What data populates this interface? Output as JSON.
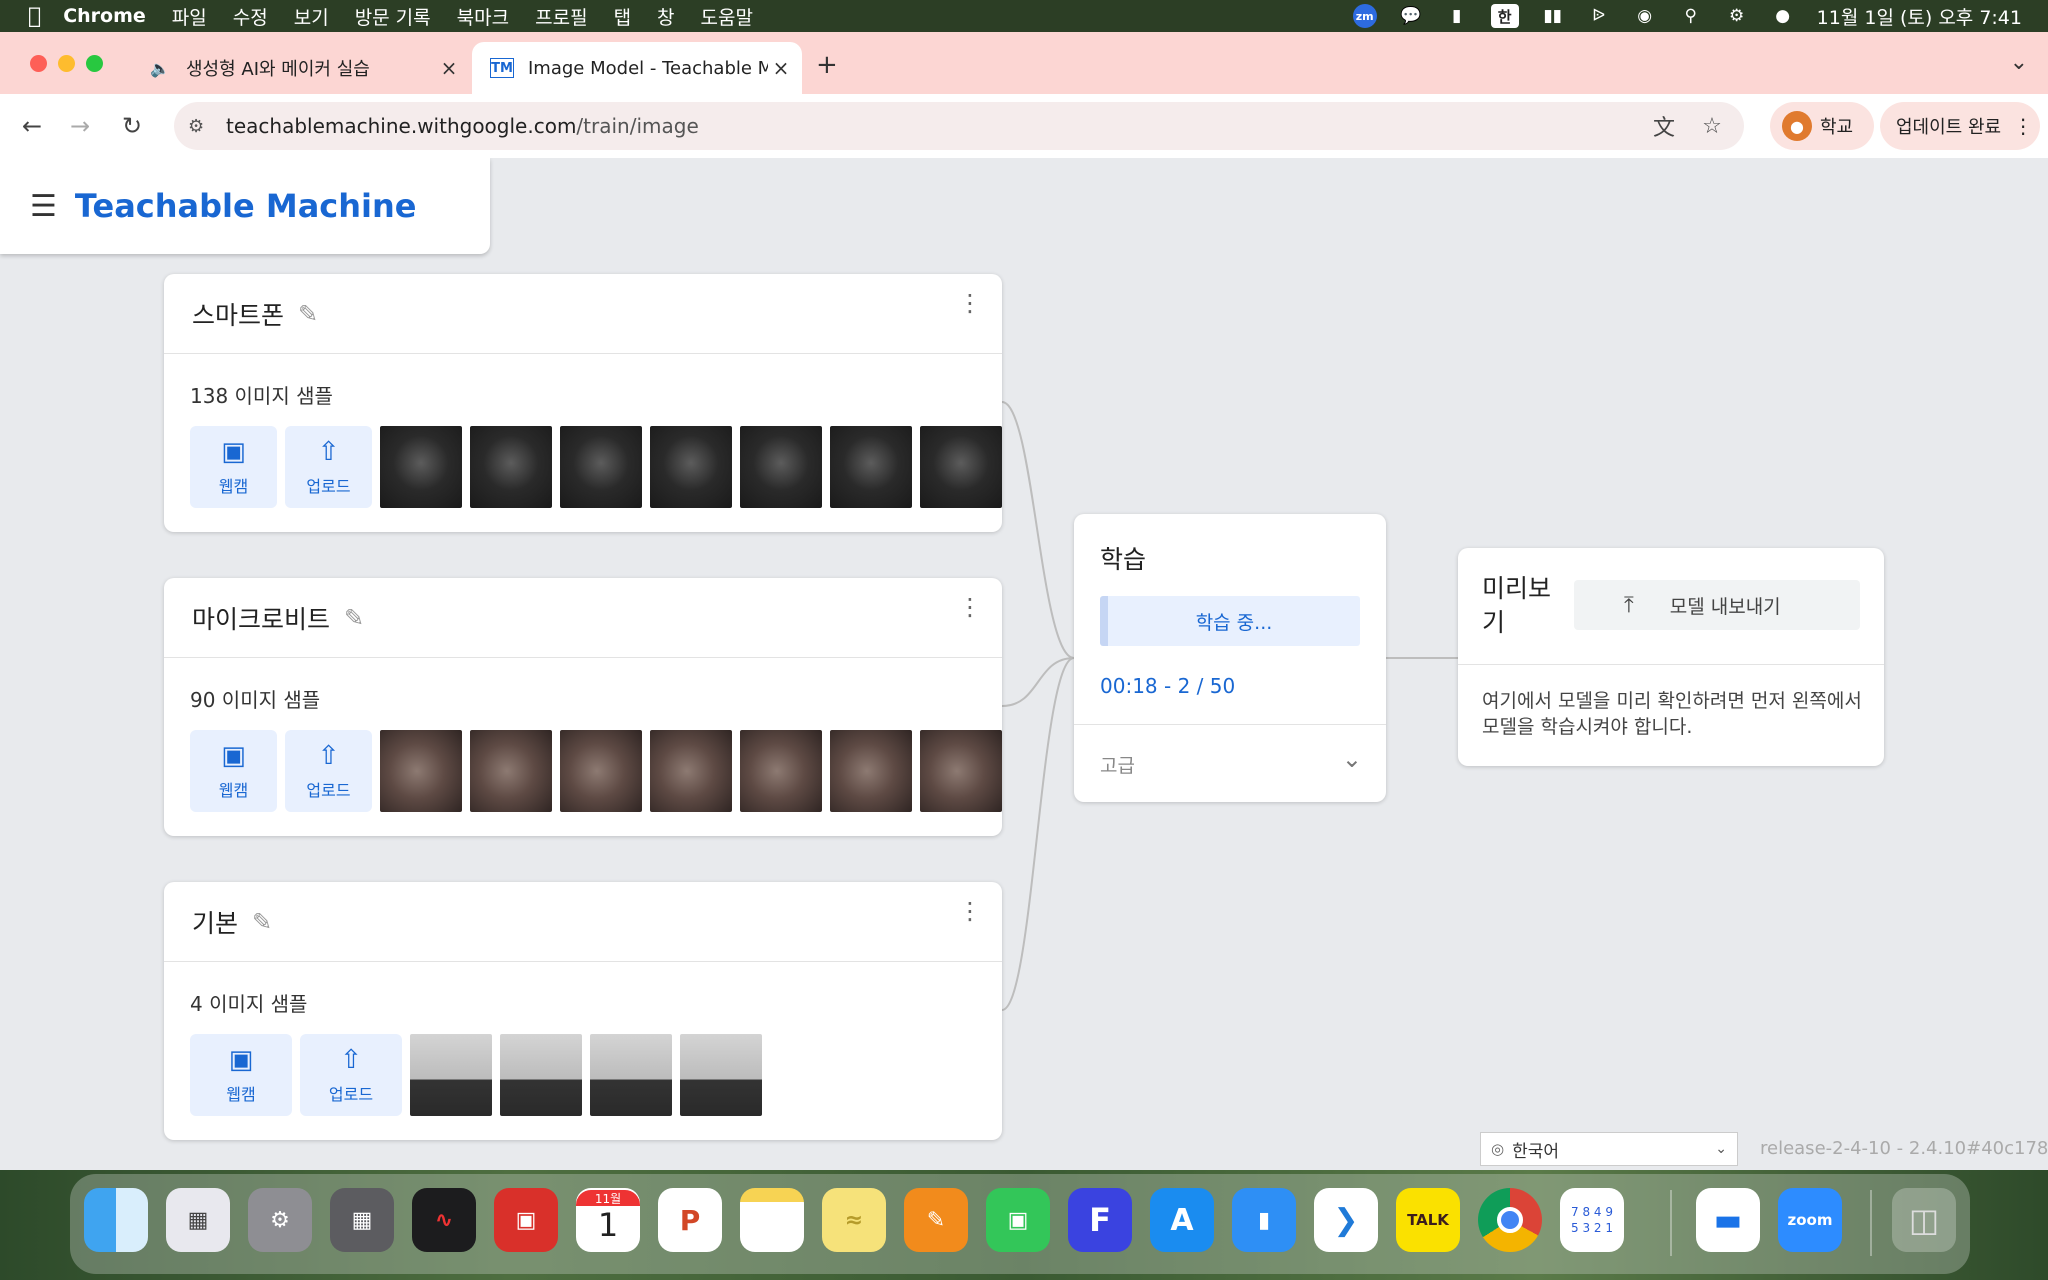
{
  "menubar": {
    "app_name": "Chrome",
    "items": [
      "파일",
      "수정",
      "보기",
      "방문 기록",
      "북마크",
      "프로필",
      "탭",
      "창",
      "도움말"
    ],
    "zoom_label": "zm",
    "input_method": "한",
    "clock": "11월 1일 (토) 오후 7:41"
  },
  "browser": {
    "tabs": [
      {
        "title": "생성형 AI와 메이커 실습"
      },
      {
        "title": "Image Model - Teachable Machine",
        "favicon": "TM"
      }
    ],
    "url_host": "teachablemachine.withgoogle.com",
    "url_path": "/train/image",
    "profile_label": "학교",
    "update_label": "업데이트 완료"
  },
  "app": {
    "brand": "Teachable Machine"
  },
  "classes": [
    {
      "name": "스마트폰",
      "count": "138 이미지 샘플",
      "thumbs": [
        "dark",
        "dark",
        "dark",
        "dark",
        "dark",
        "dark",
        "dark"
      ]
    },
    {
      "name": "마이크로비트",
      "count": "90 이미지 샘플",
      "thumbs": [
        "warm",
        "warm",
        "warm",
        "warm",
        "warm",
        "warm",
        "warm"
      ]
    },
    {
      "name": "기본",
      "count": "4 이미지 샘플",
      "thumbs": [
        "gray",
        "gray",
        "gray",
        "gray"
      ]
    }
  ],
  "sample_buttons": {
    "webcam": "웹캠",
    "upload": "업로드"
  },
  "training": {
    "title": "학습",
    "button": "학습 중...",
    "progress": "00:18 - 2 / 50",
    "advanced": "고급"
  },
  "preview": {
    "title": "미리보기",
    "export": "모델 내보내기",
    "message": "여기에서 모델을 미리 확인하려면 먼저 왼쪽에서 모델을 학습시켜야 합니다."
  },
  "footer": {
    "language": "한국어",
    "version": "release-2-4-10 - 2.4.10#40c178"
  },
  "dock": {
    "calendar_month": "11월",
    "calendar_day": "1",
    "kakao_label": "TALK",
    "zoom_label": "zoom",
    "sudoku_digits": "7 8 4 9 5 3 2 1"
  }
}
